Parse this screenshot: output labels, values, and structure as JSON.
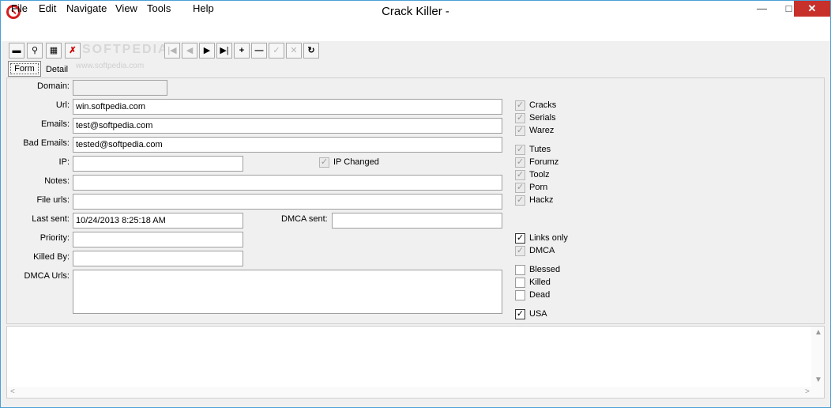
{
  "window": {
    "title": "Crack Killer -"
  },
  "menu": [
    "File",
    "Edit",
    "Navigate",
    "View",
    "Tools",
    "Help"
  ],
  "tabs": {
    "form": "Form",
    "detail": "Detail"
  },
  "form": {
    "domain_label": "Domain:",
    "url_label": "Url:",
    "url_value": "win.softpedia.com",
    "emails_label": "Emails:",
    "emails_value": "test@softpedia.com",
    "bad_emails_label": "Bad Emails:",
    "bad_emails_value": "tested@softpedia.com",
    "ip_label": "IP:",
    "ip_changed_label": "IP Changed",
    "notes_label": "Notes:",
    "file_urls_label": "File urls:",
    "last_sent_label": "Last sent:",
    "last_sent_value": "10/24/2013 8:25:18 AM",
    "dmca_sent_label": "DMCA sent:",
    "priority_label": "Priority:",
    "killed_by_label": "Killed By:",
    "dmca_urls_label": "DMCA Urls:"
  },
  "checks": {
    "cracks": "Cracks",
    "serials": "Serials",
    "warez": "Warez",
    "tutes": "Tutes",
    "forumz": "Forumz",
    "toolz": "Toolz",
    "porn": "Porn",
    "hackz": "Hackz",
    "links_only": "Links only",
    "dmca": "DMCA",
    "blessed": "Blessed",
    "killed": "Killed",
    "dead": "Dead",
    "usa": "USA"
  },
  "watermark": "SOFTPEDIA",
  "watermark_sub": "www.softpedia.com"
}
